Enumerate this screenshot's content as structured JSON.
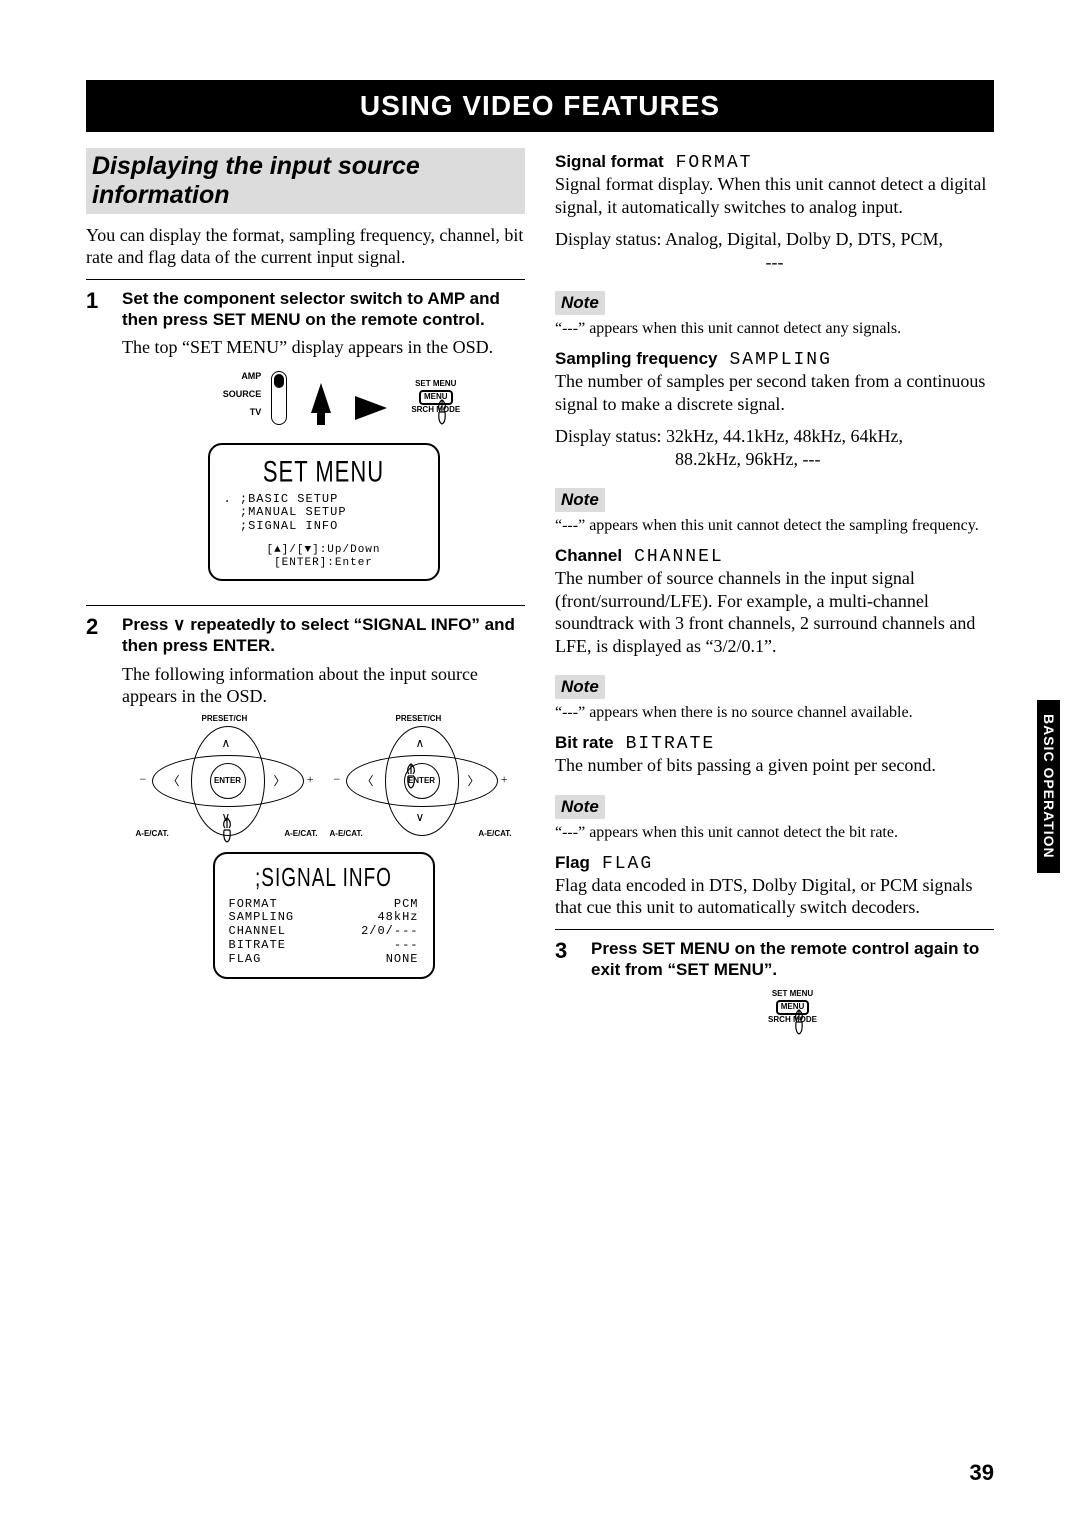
{
  "banner": "USING VIDEO FEATURES",
  "side_tab": "BASIC OPERATION",
  "page_number": "39",
  "left": {
    "section_title": "Displaying the input source information",
    "intro": "You can display the format, sampling frequency, channel, bit rate and flag data of the current input signal.",
    "step1": {
      "num": "1",
      "head": "Set the component selector switch to AMP and then press SET MENU on the remote control.",
      "body": "The top “SET MENU” display appears in the OSD.",
      "switch": {
        "amp": "AMP",
        "source": "SOURCE",
        "tv": "TV"
      },
      "menu_btn": {
        "top": "SET MENU",
        "mid": "MENU",
        "bot": "SRCH MODE"
      },
      "osd": {
        "title": "SET MENU",
        "lines": [
          ". ;BASIC SETUP",
          "  ;MANUAL SETUP",
          "  ;SIGNAL INFO"
        ],
        "footer": "[▲]/[▼]:Up/Down\n[ENTER]:Enter"
      }
    },
    "step2": {
      "num": "2",
      "head": "Press ∨ repeatedly to select “SIGNAL INFO” and then press ENTER.",
      "body": "The following information about the input source appears in the OSD.",
      "dpad": {
        "top": "PRESET/CH",
        "bottom": "A-E/CAT.",
        "center": "ENTER",
        "minus": "−",
        "plus": "+"
      },
      "osd": {
        "title": ";SIGNAL INFO",
        "rows": [
          [
            "FORMAT",
            "PCM"
          ],
          [
            "SAMPLING",
            "48kHz"
          ],
          [
            "CHANNEL",
            "2/0/---"
          ],
          [
            "BITRATE",
            "---"
          ],
          [
            "FLAG",
            "NONE"
          ]
        ]
      }
    }
  },
  "right": {
    "signal_format": {
      "head": "Signal format",
      "code": "FORMAT",
      "body": "Signal format display. When this unit cannot detect a digital signal, it automatically switches to analog input.",
      "status": "Display status: Analog, Digital, Dolby D, DTS, PCM,",
      "status2": "---",
      "note_label": "Note",
      "note": "“---” appears when this unit cannot detect any signals."
    },
    "sampling": {
      "head": "Sampling frequency",
      "code": "SAMPLING",
      "body": "The number of samples per second taken from a continuous signal to make a discrete signal.",
      "status": "Display status: 32kHz, 44.1kHz, 48kHz, 64kHz,",
      "status2": "88.2kHz, 96kHz, ---",
      "note_label": "Note",
      "note": "“---” appears when this unit cannot detect the sampling frequency."
    },
    "channel": {
      "head": "Channel",
      "code": "CHANNEL",
      "body": "The number of source channels in the input signal (front/surround/LFE). For example, a multi-channel soundtrack with 3 front channels, 2 surround channels and LFE, is displayed as “3/2/0.1”.",
      "note_label": "Note",
      "note": "“---” appears when there is no source channel available."
    },
    "bitrate": {
      "head": "Bit rate",
      "code": "BITRATE",
      "body": "The number of bits passing a given point per second.",
      "note_label": "Note",
      "note": "“---” appears when this unit cannot detect the bit rate."
    },
    "flag": {
      "head": "Flag",
      "code": "FLAG",
      "body": "Flag data encoded in DTS, Dolby Digital, or PCM signals that cue this unit to automatically switch decoders."
    },
    "step3": {
      "num": "3",
      "head": "Press SET MENU on the remote control again to exit from “SET MENU”.",
      "menu_btn": {
        "top": "SET MENU",
        "mid": "MENU",
        "bot": "SRCH MODE"
      }
    }
  }
}
